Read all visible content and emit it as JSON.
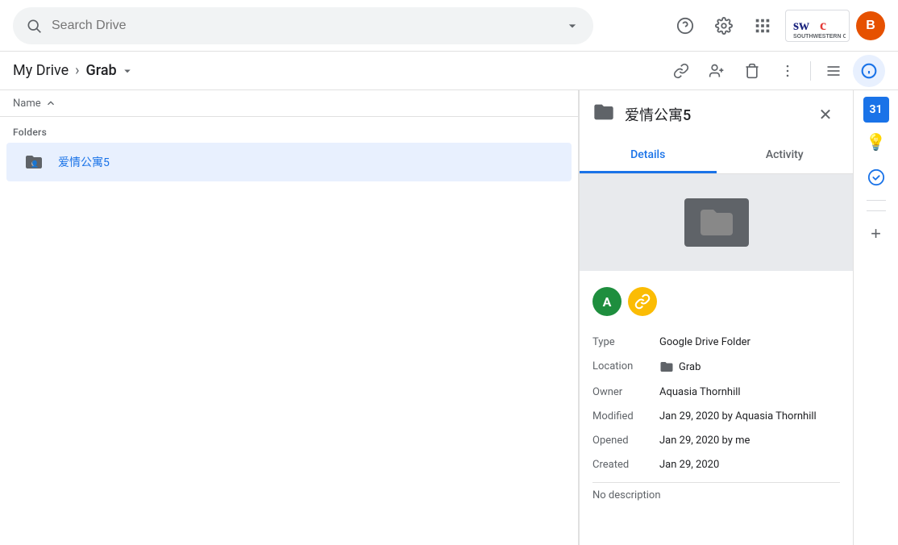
{
  "header": {
    "search_placeholder": "Search Drive",
    "search_value": "",
    "avatar_initial": "B",
    "swc_logo_text": "swc"
  },
  "breadcrumb": {
    "parent": "My Drive",
    "separator": "›",
    "current": "Grab",
    "dropdown_icon": "▾"
  },
  "toolbar": {
    "link_icon": "🔗",
    "add_person_icon": "👤",
    "delete_icon": "🗑",
    "more_icon": "⋮",
    "list_view_icon": "☰",
    "info_icon": "ℹ"
  },
  "file_list": {
    "column_name": "Name",
    "sort_icon": "↑",
    "sections": [
      {
        "label": "Folders",
        "items": [
          {
            "name": "爱情公寓5",
            "type": "shared_folder",
            "icon": "📁"
          }
        ]
      }
    ]
  },
  "details_panel": {
    "folder_icon": "📁",
    "title": "爱情公寓5",
    "close_icon": "✕",
    "tabs": [
      {
        "id": "details",
        "label": "Details",
        "active": true
      },
      {
        "id": "activity",
        "label": "Activity",
        "active": false
      }
    ],
    "share_avatars": [
      {
        "initial": "A",
        "color": "teal",
        "type": "person"
      },
      {
        "initial": "🔗",
        "color": "link-icon",
        "type": "link"
      }
    ],
    "details": {
      "type_label": "Type",
      "type_value": "Google Drive Folder",
      "location_label": "Location",
      "location_folder_icon": "📁",
      "location_value": "Grab",
      "owner_label": "Owner",
      "owner_value": "Aquasia Thornhill",
      "modified_label": "Modified",
      "modified_value": "Jan 29, 2020 by Aquasia Thornhill",
      "opened_label": "Opened",
      "opened_value": "Jan 29, 2020 by me",
      "created_label": "Created",
      "created_value": "Jan 29, 2020",
      "no_description": "No description"
    }
  },
  "right_sidebar": {
    "calendar_label": "31",
    "bulb_icon": "💡",
    "task_icon": "✔",
    "plus_icon": "+"
  }
}
